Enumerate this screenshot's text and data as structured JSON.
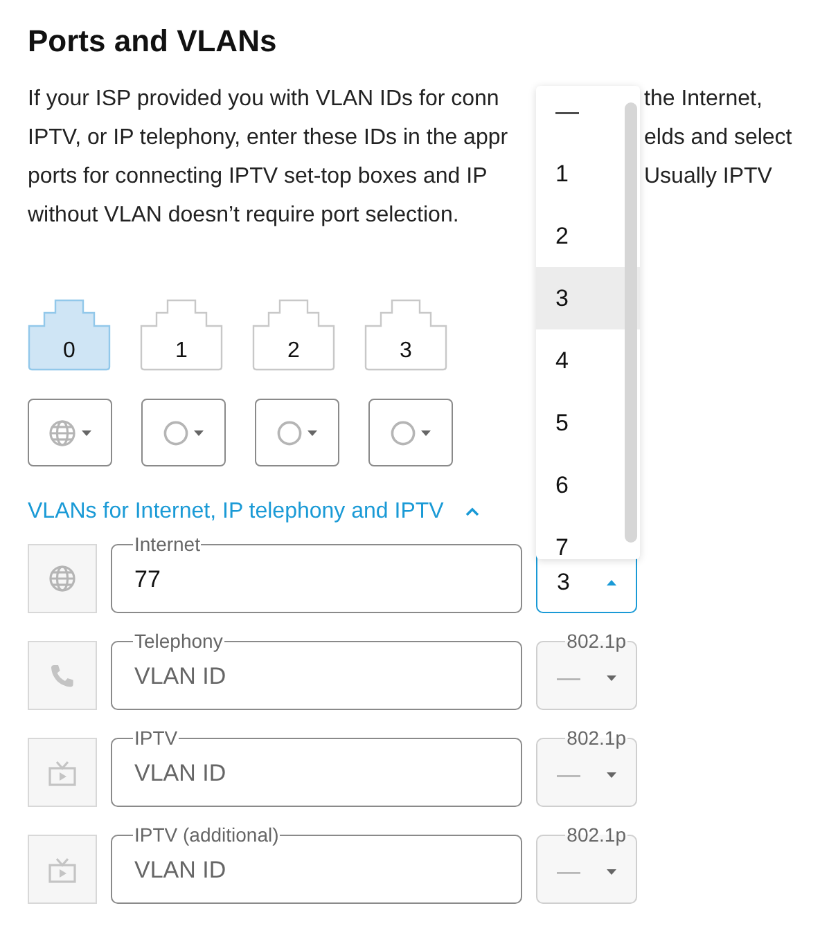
{
  "title": "Ports and VLANs",
  "intro_lines": [
    {
      "left": "If your ISP provided you with VLAN IDs for conn",
      "right": "the Internet,"
    },
    {
      "left": "IPTV, or IP telephony, enter these IDs in the appr",
      "right": "elds and select"
    },
    {
      "left": "ports for connecting IPTV set-top boxes and IP",
      "right": "Usually IPTV"
    },
    {
      "left": "without VLAN doesn’t require port selection."
    }
  ],
  "ports": [
    {
      "label": "0",
      "selected": true
    },
    {
      "label": "1",
      "selected": false
    },
    {
      "label": "2",
      "selected": false
    },
    {
      "label": "3",
      "selected": false
    }
  ],
  "port_modes": [
    {
      "kind": "internet"
    },
    {
      "kind": "none"
    },
    {
      "kind": "none"
    },
    {
      "kind": "none"
    }
  ],
  "vlan_section": {
    "title": "VLANs for Internet, IP telephony and IPTV",
    "expanded": true
  },
  "vlans": [
    {
      "kind": "internet",
      "label": "Internet",
      "value": "77",
      "priority_value": "3",
      "open": true,
      "disabled": false
    },
    {
      "kind": "telephony",
      "label": "Telephony",
      "placeholder": "VLAN ID",
      "priority_label": "802.1p",
      "priority_value": "—",
      "open": false,
      "disabled": true
    },
    {
      "kind": "iptv",
      "label": "IPTV",
      "placeholder": "VLAN ID",
      "priority_label": "802.1p",
      "priority_value": "—",
      "open": false,
      "disabled": true
    },
    {
      "kind": "iptv",
      "label": "IPTV (additional)",
      "placeholder": "VLAN ID",
      "priority_label": "802.1p",
      "priority_value": "—",
      "open": false,
      "disabled": true
    }
  ],
  "priority_dropdown": {
    "options": [
      {
        "label": "—",
        "selected": false
      },
      {
        "label": "1",
        "selected": false
      },
      {
        "label": "2",
        "selected": false
      },
      {
        "label": "3",
        "selected": true
      },
      {
        "label": "4",
        "selected": false
      },
      {
        "label": "5",
        "selected": false
      },
      {
        "label": "6",
        "selected": false
      },
      {
        "label": "7",
        "selected": false
      }
    ]
  }
}
